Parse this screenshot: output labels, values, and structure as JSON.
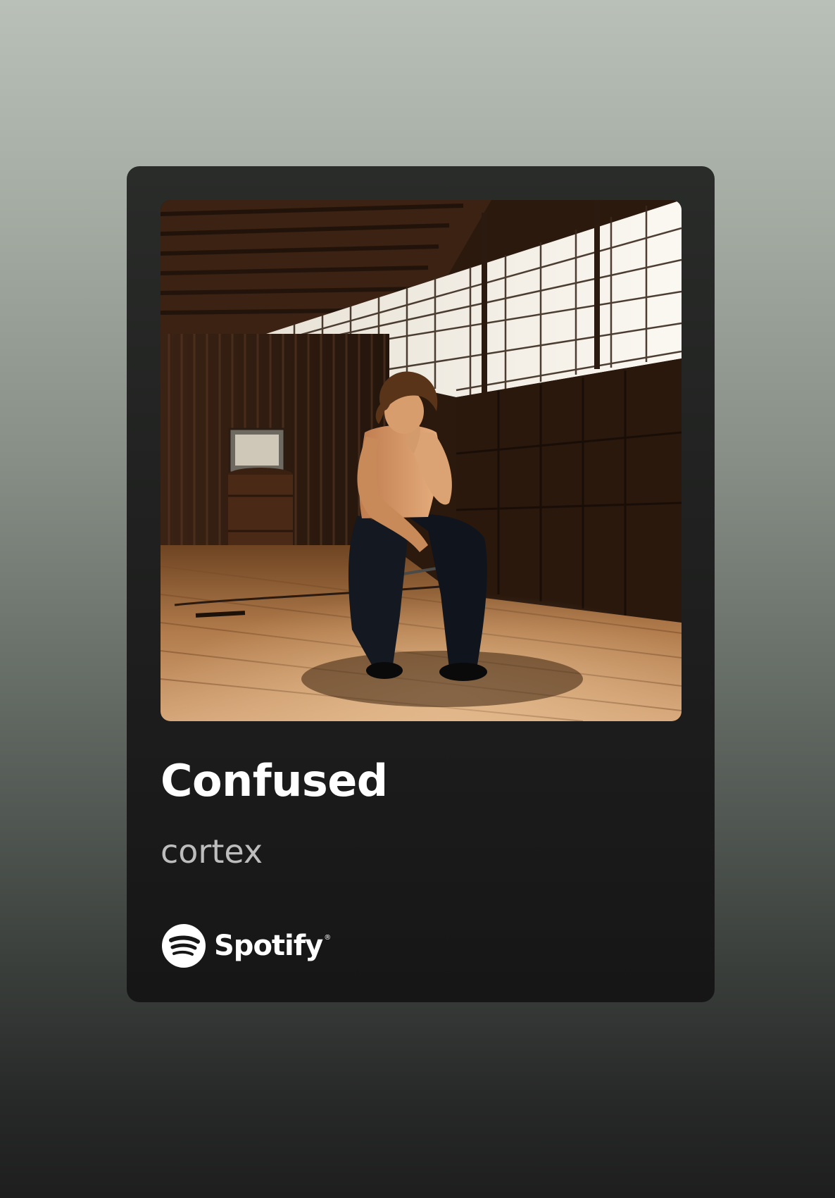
{
  "share_card": {
    "title": "Confused",
    "artist": "cortex",
    "brand": "Spotify",
    "brand_mark": "®",
    "brand_color": "#ffffff",
    "icons": {
      "brand": "spotify-logo-icon"
    }
  }
}
